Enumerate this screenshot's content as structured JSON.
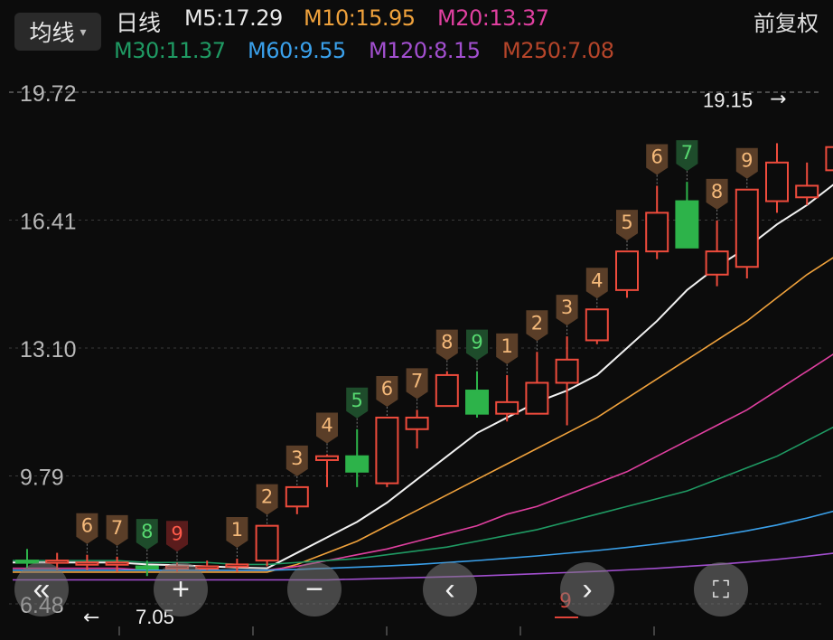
{
  "header": {
    "ma_button": {
      "label": "均线",
      "caret": "▾"
    },
    "period": "日线",
    "adjust_label": "前复权",
    "ma_values": [
      {
        "label": "M5:17.29",
        "color": "#e8e8e8"
      },
      {
        "label": "M10:15.95",
        "color": "#f0a23c"
      },
      {
        "label": "M20:13.37",
        "color": "#e040a0"
      },
      {
        "label": "M30:11.37",
        "color": "#1f9a63"
      },
      {
        "label": "M60:9.55",
        "color": "#3aa0ea"
      },
      {
        "label": "M120:8.15",
        "color": "#a24fcf"
      },
      {
        "label": "M250:7.08",
        "color": "#b5452a"
      }
    ]
  },
  "controls": [
    {
      "name": "scroll-left-fast-button",
      "icon": "«"
    },
    {
      "name": "zoom-in-button",
      "icon": "+"
    },
    {
      "name": "zoom-out-button",
      "icon": "−"
    },
    {
      "name": "scroll-left-button",
      "icon": "‹"
    },
    {
      "name": "scroll-right-button",
      "icon": "›"
    },
    {
      "name": "fullscreen-button",
      "icon": "⛶"
    }
  ],
  "chart_data": {
    "type": "candlestick",
    "y_ticks": [
      "19.72",
      "16.41",
      "13.10",
      "9.79",
      "6.48"
    ],
    "ylim": [
      6.48,
      19.72
    ],
    "grid": true,
    "high_marker": {
      "label": "19.15",
      "arrow": "→"
    },
    "low_marker": {
      "label": "7.05",
      "arrow": "←"
    },
    "bottom_marker": "9",
    "colors": {
      "up": "#ee4b3c",
      "down": "#2db34a",
      "grid": "#3a3a3a"
    },
    "candles": [
      {
        "o": 7.6,
        "c": 7.6,
        "h": 7.9,
        "l": 7.4,
        "dir": "down",
        "count": ""
      },
      {
        "o": 7.6,
        "c": 7.55,
        "h": 7.8,
        "l": 7.35,
        "dir": "up",
        "count": ""
      },
      {
        "o": 7.55,
        "c": 7.55,
        "h": 7.75,
        "l": 7.35,
        "dir": "up",
        "count": "6"
      },
      {
        "o": 7.55,
        "c": 7.55,
        "h": 7.7,
        "l": 7.3,
        "dir": "up",
        "count": "7"
      },
      {
        "o": 7.45,
        "c": 7.4,
        "h": 7.6,
        "l": 7.2,
        "dir": "down",
        "count": "8"
      },
      {
        "o": 7.45,
        "c": 7.4,
        "h": 7.55,
        "l": 7.3,
        "dir": "up",
        "count": "9"
      },
      {
        "o": 7.45,
        "c": 7.45,
        "h": 7.6,
        "l": 7.35,
        "dir": "up",
        "count": ""
      },
      {
        "o": 7.5,
        "c": 7.5,
        "h": 7.65,
        "l": 7.3,
        "dir": "up",
        "count": "1"
      },
      {
        "o": 7.6,
        "c": 8.5,
        "h": 8.5,
        "l": 7.45,
        "dir": "up",
        "count": "2"
      },
      {
        "o": 9.0,
        "c": 9.5,
        "h": 9.5,
        "l": 8.8,
        "dir": "up",
        "count": "3"
      },
      {
        "o": 10.2,
        "c": 10.3,
        "h": 10.35,
        "l": 9.5,
        "dir": "up",
        "count": "4"
      },
      {
        "o": 10.3,
        "c": 9.9,
        "h": 11.0,
        "l": 9.5,
        "dir": "down",
        "count": "5"
      },
      {
        "o": 9.6,
        "c": 11.3,
        "h": 11.3,
        "l": 9.5,
        "dir": "up",
        "count": "6"
      },
      {
        "o": 11.0,
        "c": 11.3,
        "h": 11.5,
        "l": 10.5,
        "dir": "up",
        "count": "7"
      },
      {
        "o": 11.6,
        "c": 12.4,
        "h": 12.5,
        "l": 11.6,
        "dir": "up",
        "count": "8"
      },
      {
        "o": 12.0,
        "c": 11.4,
        "h": 12.5,
        "l": 11.3,
        "dir": "down",
        "count": "9"
      },
      {
        "o": 11.4,
        "c": 11.7,
        "h": 12.4,
        "l": 11.2,
        "dir": "up",
        "count": "1"
      },
      {
        "o": 11.4,
        "c": 12.2,
        "h": 13.0,
        "l": 11.4,
        "dir": "up",
        "count": "2"
      },
      {
        "o": 12.2,
        "c": 12.8,
        "h": 13.4,
        "l": 11.1,
        "dir": "up",
        "count": "3"
      },
      {
        "o": 13.3,
        "c": 14.1,
        "h": 14.1,
        "l": 13.2,
        "dir": "up",
        "count": "4"
      },
      {
        "o": 14.6,
        "c": 15.6,
        "h": 15.6,
        "l": 14.4,
        "dir": "up",
        "count": "5"
      },
      {
        "o": 15.6,
        "c": 16.6,
        "h": 17.3,
        "l": 15.4,
        "dir": "up",
        "count": "6"
      },
      {
        "o": 16.9,
        "c": 15.7,
        "h": 17.4,
        "l": 15.7,
        "dir": "down",
        "count": "7"
      },
      {
        "o": 15.0,
        "c": 15.6,
        "h": 16.4,
        "l": 14.7,
        "dir": "up",
        "count": "8"
      },
      {
        "o": 15.2,
        "c": 17.2,
        "h": 17.2,
        "l": 14.9,
        "dir": "up",
        "count": "9"
      },
      {
        "o": 16.9,
        "c": 17.9,
        "h": 18.4,
        "l": 16.6,
        "dir": "up",
        "count": ""
      },
      {
        "o": 17.0,
        "c": 17.3,
        "h": 17.9,
        "l": 16.8,
        "dir": "up",
        "count": ""
      },
      {
        "o": 17.7,
        "c": 18.3,
        "h": 19.0,
        "l": 16.6,
        "dir": "up",
        "count": ""
      },
      {
        "o": 18.5,
        "c": 19.15,
        "h": 19.15,
        "l": 18.2,
        "dir": "up",
        "count": ""
      }
    ],
    "ma_series": [
      {
        "name": "M5",
        "color": "#f2f2f2",
        "values": [
          7.55,
          7.55,
          7.55,
          7.55,
          7.5,
          7.48,
          7.45,
          7.42,
          7.4,
          7.8,
          8.2,
          8.6,
          9.1,
          9.7,
          10.3,
          10.9,
          11.3,
          11.7,
          12.0,
          12.4,
          13.1,
          13.8,
          14.6,
          15.2,
          15.7,
          16.3,
          16.8,
          17.4,
          18.3
        ]
      },
      {
        "name": "M10",
        "color": "#f0a23c",
        "values": [
          7.3,
          7.3,
          7.3,
          7.3,
          7.3,
          7.3,
          7.3,
          7.3,
          7.3,
          7.5,
          7.8,
          8.1,
          8.5,
          8.9,
          9.3,
          9.7,
          10.1,
          10.5,
          10.9,
          11.3,
          11.8,
          12.3,
          12.8,
          13.3,
          13.8,
          14.4,
          15.0,
          15.5,
          16.2
        ]
      },
      {
        "name": "M20",
        "color": "#e040a0",
        "values": [
          7.4,
          7.4,
          7.4,
          7.4,
          7.35,
          7.35,
          7.35,
          7.35,
          7.35,
          7.45,
          7.6,
          7.75,
          7.9,
          8.1,
          8.3,
          8.5,
          8.8,
          9.0,
          9.3,
          9.6,
          9.9,
          10.3,
          10.7,
          11.1,
          11.5,
          12.0,
          12.5,
          13.0,
          13.6
        ]
      },
      {
        "name": "M30",
        "color": "#1f9a63",
        "values": [
          7.6,
          7.6,
          7.6,
          7.6,
          7.55,
          7.55,
          7.55,
          7.5,
          7.5,
          7.55,
          7.6,
          7.65,
          7.75,
          7.85,
          7.95,
          8.1,
          8.25,
          8.4,
          8.6,
          8.8,
          9.0,
          9.2,
          9.4,
          9.7,
          10.0,
          10.3,
          10.7,
          11.1,
          11.5
        ]
      },
      {
        "name": "M60",
        "color": "#3aa0ea",
        "values": [
          7.35,
          7.35,
          7.35,
          7.35,
          7.35,
          7.35,
          7.35,
          7.35,
          7.35,
          7.37,
          7.4,
          7.43,
          7.46,
          7.5,
          7.55,
          7.6,
          7.66,
          7.72,
          7.79,
          7.86,
          7.94,
          8.03,
          8.13,
          8.24,
          8.37,
          8.52,
          8.7,
          8.9,
          9.15
        ]
      },
      {
        "name": "M120",
        "color": "#a24fcf",
        "values": [
          7.1,
          7.1,
          7.1,
          7.1,
          7.1,
          7.1,
          7.1,
          7.1,
          7.1,
          7.1,
          7.1,
          7.12,
          7.14,
          7.16,
          7.18,
          7.2,
          7.23,
          7.26,
          7.29,
          7.32,
          7.36,
          7.4,
          7.45,
          7.5,
          7.56,
          7.63,
          7.71,
          7.8,
          7.9
        ]
      }
    ]
  }
}
